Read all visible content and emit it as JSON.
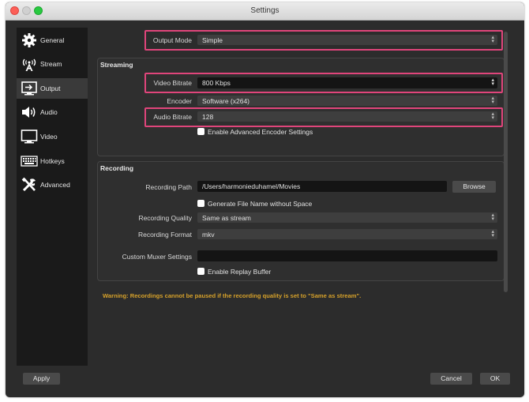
{
  "window": {
    "title": "Settings"
  },
  "sidebar": {
    "items": [
      {
        "label": "General",
        "icon": "gear-icon"
      },
      {
        "label": "Stream",
        "icon": "broadcast-icon"
      },
      {
        "label": "Output",
        "icon": "output-monitor-icon"
      },
      {
        "label": "Audio",
        "icon": "speaker-icon"
      },
      {
        "label": "Video",
        "icon": "monitor-icon"
      },
      {
        "label": "Hotkeys",
        "icon": "keyboard-icon"
      },
      {
        "label": "Advanced",
        "icon": "tools-icon"
      }
    ],
    "active": "Output"
  },
  "output_mode": {
    "label": "Output Mode",
    "value": "Simple"
  },
  "streaming": {
    "title": "Streaming",
    "video_bitrate": {
      "label": "Video Bitrate",
      "value": "800 Kbps"
    },
    "encoder": {
      "label": "Encoder",
      "value": "Software (x264)"
    },
    "audio_bitrate": {
      "label": "Audio Bitrate",
      "value": "128"
    },
    "advanced_encoder": {
      "label": "Enable Advanced Encoder Settings",
      "checked": false
    }
  },
  "recording": {
    "title": "Recording",
    "path": {
      "label": "Recording Path",
      "value": "/Users/harmonieduhamel/Movies",
      "browse": "Browse"
    },
    "no_space": {
      "label": "Generate File Name without Space",
      "checked": false
    },
    "quality": {
      "label": "Recording Quality",
      "value": "Same as stream"
    },
    "format": {
      "label": "Recording Format",
      "value": "mkv"
    },
    "muxer": {
      "label": "Custom Muxer Settings",
      "value": ""
    },
    "replay_buffer": {
      "label": "Enable Replay Buffer",
      "checked": false
    }
  },
  "warning": "Warning: Recordings cannot be paused if the recording quality is set to \"Same as stream\".",
  "buttons": {
    "apply": "Apply",
    "cancel": "Cancel",
    "ok": "OK"
  },
  "colors": {
    "highlight": "#e0457b",
    "warning": "#d6a12a",
    "background": "#2c2c2c"
  }
}
